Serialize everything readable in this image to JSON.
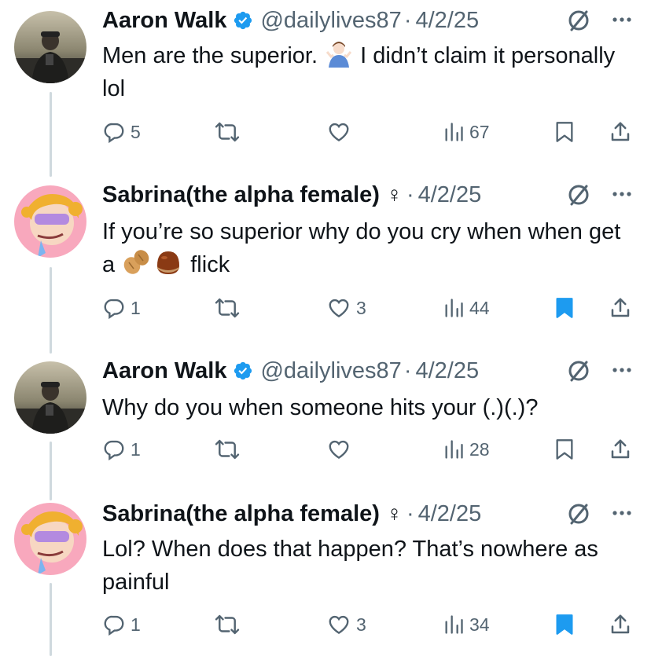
{
  "tweets": [
    {
      "author": {
        "name": "Aaron Walk",
        "verified": true,
        "handle": "@dailylives87"
      },
      "date": "4/2/25",
      "text_before": "Men are the superior. ",
      "emoji_1": "person-shrugging",
      "text_after": " I didn’t claim it personally lol",
      "stats": {
        "replies": "5",
        "retweets": "",
        "likes": "",
        "views": "67",
        "bookmarked": false
      }
    },
    {
      "author": {
        "name": "Sabrina(the alpha female)",
        "symbol": "♀",
        "handle": ""
      },
      "date": "4/2/25",
      "text_before": "If you’re so superior why do you cry when when get a ",
      "emoji_1": "peanut",
      "emoji_2": "chestnut",
      "text_after": " flick",
      "stats": {
        "replies": "1",
        "retweets": "",
        "likes": "3",
        "views": "44",
        "bookmarked": true
      }
    },
    {
      "author": {
        "name": "Aaron Walk",
        "verified": true,
        "handle": "@dailylives87"
      },
      "date": "4/2/25",
      "text": "Why do you when someone hits your (.)(.)?",
      "stats": {
        "replies": "1",
        "retweets": "",
        "likes": "",
        "views": "28",
        "bookmarked": false
      }
    },
    {
      "author": {
        "name": "Sabrina(the alpha female)",
        "symbol": "♀",
        "handle": ""
      },
      "date": "4/2/25",
      "text": "Lol? When does that happen? That’s nowhere as painful",
      "stats": {
        "replies": "1",
        "retweets": "",
        "likes": "3",
        "views": "34",
        "bookmarked": true
      }
    }
  ],
  "separator": "·",
  "colors": {
    "text": "#0f1419",
    "secondary": "#536471",
    "accent": "#1d9bf0",
    "thread_line": "#cfd9de"
  }
}
